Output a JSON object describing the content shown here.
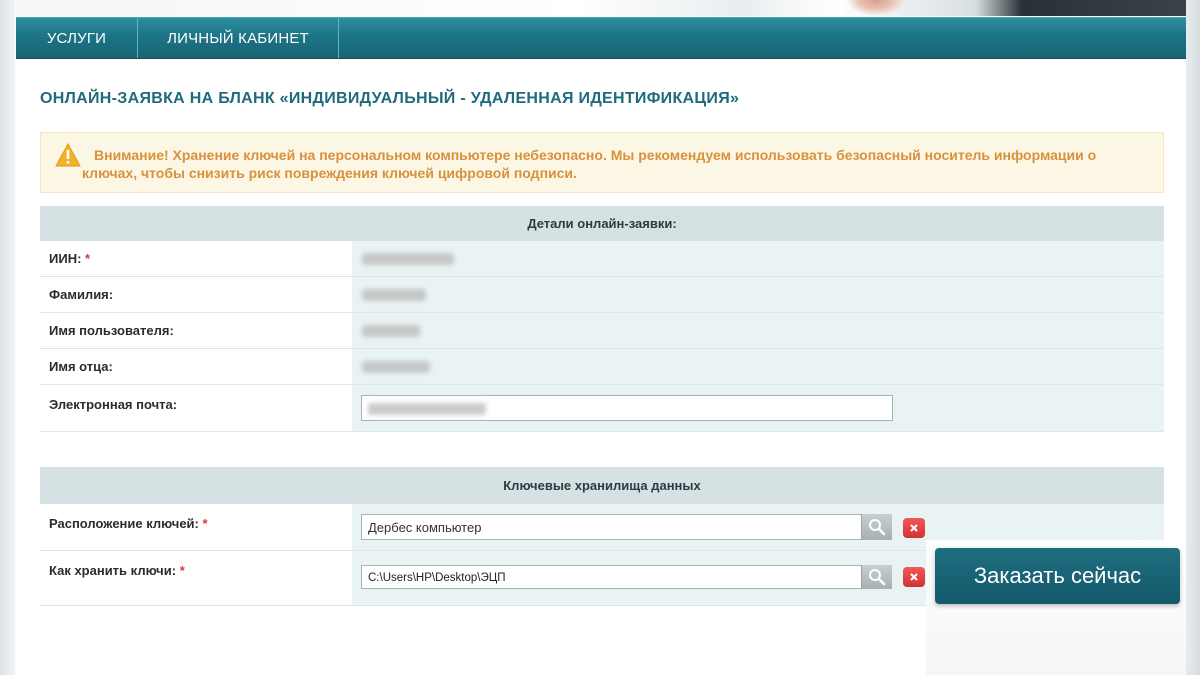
{
  "nav": {
    "services": "УСЛУГИ",
    "cabinet": "ЛИЧНЫЙ КАБИНЕТ"
  },
  "page_title": "ОНЛАЙН-ЗАЯВКА НА БЛАНК «ИНДИВИДУАЛЬНЫЙ - УДАЛЕННАЯ ИДЕНТИФИКАЦИЯ»",
  "warning": {
    "icon": "warning-triangle-icon",
    "text": "Внимание! Хранение ключей на персональном компьютере небезопасно. Мы рекомендуем использовать безопасный носитель информации о ключах, чтобы снизить риск повреждения ключей цифровой подписи."
  },
  "details": {
    "header": "Детали онлайн-заявки:",
    "rows": [
      {
        "label": "ИИН:",
        "required": "*"
      },
      {
        "label": "Фамилия:"
      },
      {
        "label": "Имя пользователя:"
      },
      {
        "label": "Имя отца:"
      },
      {
        "label": "Электронная почта:"
      }
    ]
  },
  "storage": {
    "header": "Ключевые хранилища данных",
    "location_label": "Расположение ключей:",
    "location_required": "*",
    "location_value": "Дербес компьютер",
    "how_label": "Как хранить ключи:",
    "how_required": "*",
    "how_value": "C:\\Users\\HP\\Desktop\\ЭЦП"
  },
  "order_button": "Заказать сейчас",
  "colors": {
    "nav": "#1d7486",
    "title": "#1f6a7d",
    "warning_text": "#d8913c",
    "warning_bg": "#fcf6e4",
    "order_button": "#15596a",
    "delete_button": "#e04444"
  }
}
